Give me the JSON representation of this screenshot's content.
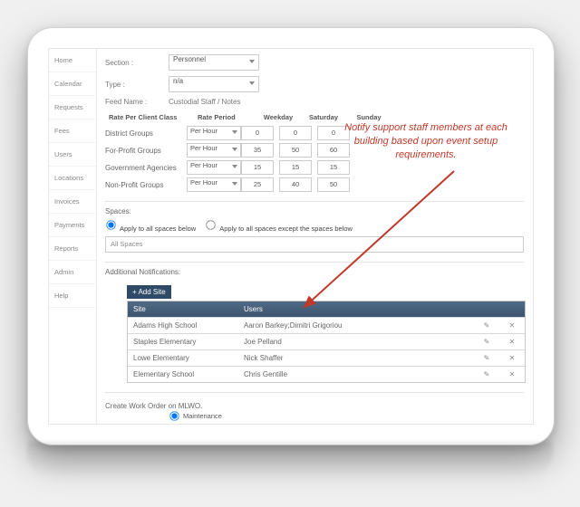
{
  "sidenav": {
    "items": [
      {
        "label": "Home"
      },
      {
        "label": "Calendar"
      },
      {
        "label": "Requests"
      },
      {
        "label": "Fees"
      },
      {
        "label": "Users"
      },
      {
        "label": "Locations"
      },
      {
        "label": "Invoices"
      },
      {
        "label": "Payments"
      },
      {
        "label": "Reports"
      },
      {
        "label": "Admin"
      },
      {
        "label": "Help"
      }
    ]
  },
  "fields": {
    "section_label": "Section :",
    "section_value": "Personnel",
    "type_label": "Type :",
    "type_value": "n/a",
    "feedname_label": "Feed Name :",
    "feedname_value": "Custodial Staff / Notes"
  },
  "rategrid": {
    "title": "Rate Per Client Class",
    "headers": {
      "period": "Rate Period",
      "weekday": "Weekday",
      "saturday": "Saturday",
      "sunday": "Sunday"
    },
    "rows": [
      {
        "label": "District Groups",
        "period": "Per Hour",
        "weekday": "0",
        "saturday": "0",
        "sunday": "0"
      },
      {
        "label": "For-Profit Groups",
        "period": "Per Hour",
        "weekday": "35",
        "saturday": "50",
        "sunday": "60"
      },
      {
        "label": "Government Agencies",
        "period": "Per Hour",
        "weekday": "15",
        "saturday": "15",
        "sunday": "15"
      },
      {
        "label": "Non-Profit Groups",
        "period": "Per Hour",
        "weekday": "25",
        "saturday": "40",
        "sunday": "50"
      }
    ]
  },
  "spaces": {
    "title": "Spaces:",
    "opt1": "Apply to all spaces below",
    "opt2": "Apply to all spaces except the spaces below",
    "allspaces": "All Spaces"
  },
  "notif": {
    "title": "Additional Notifications:",
    "addsite": "+  Add Site",
    "head_site": "Site",
    "head_users": "Users",
    "rows": [
      {
        "site": "Adams High School",
        "users": "Aaron Barkey;Dimitri Grigoriou"
      },
      {
        "site": "Staples Elementary",
        "users": "Joe Pelland"
      },
      {
        "site": "Lowe Elementary",
        "users": "Nick Shaffer"
      },
      {
        "site": "Elementary School",
        "users": "Chris Gentille"
      }
    ],
    "edit": "✎",
    "del": "✕"
  },
  "callout": "Notify support staff members at each building based upon event setup requirements.",
  "wo": {
    "title": "Create Work Order on MLWO.",
    "opt": "Maintenance"
  }
}
